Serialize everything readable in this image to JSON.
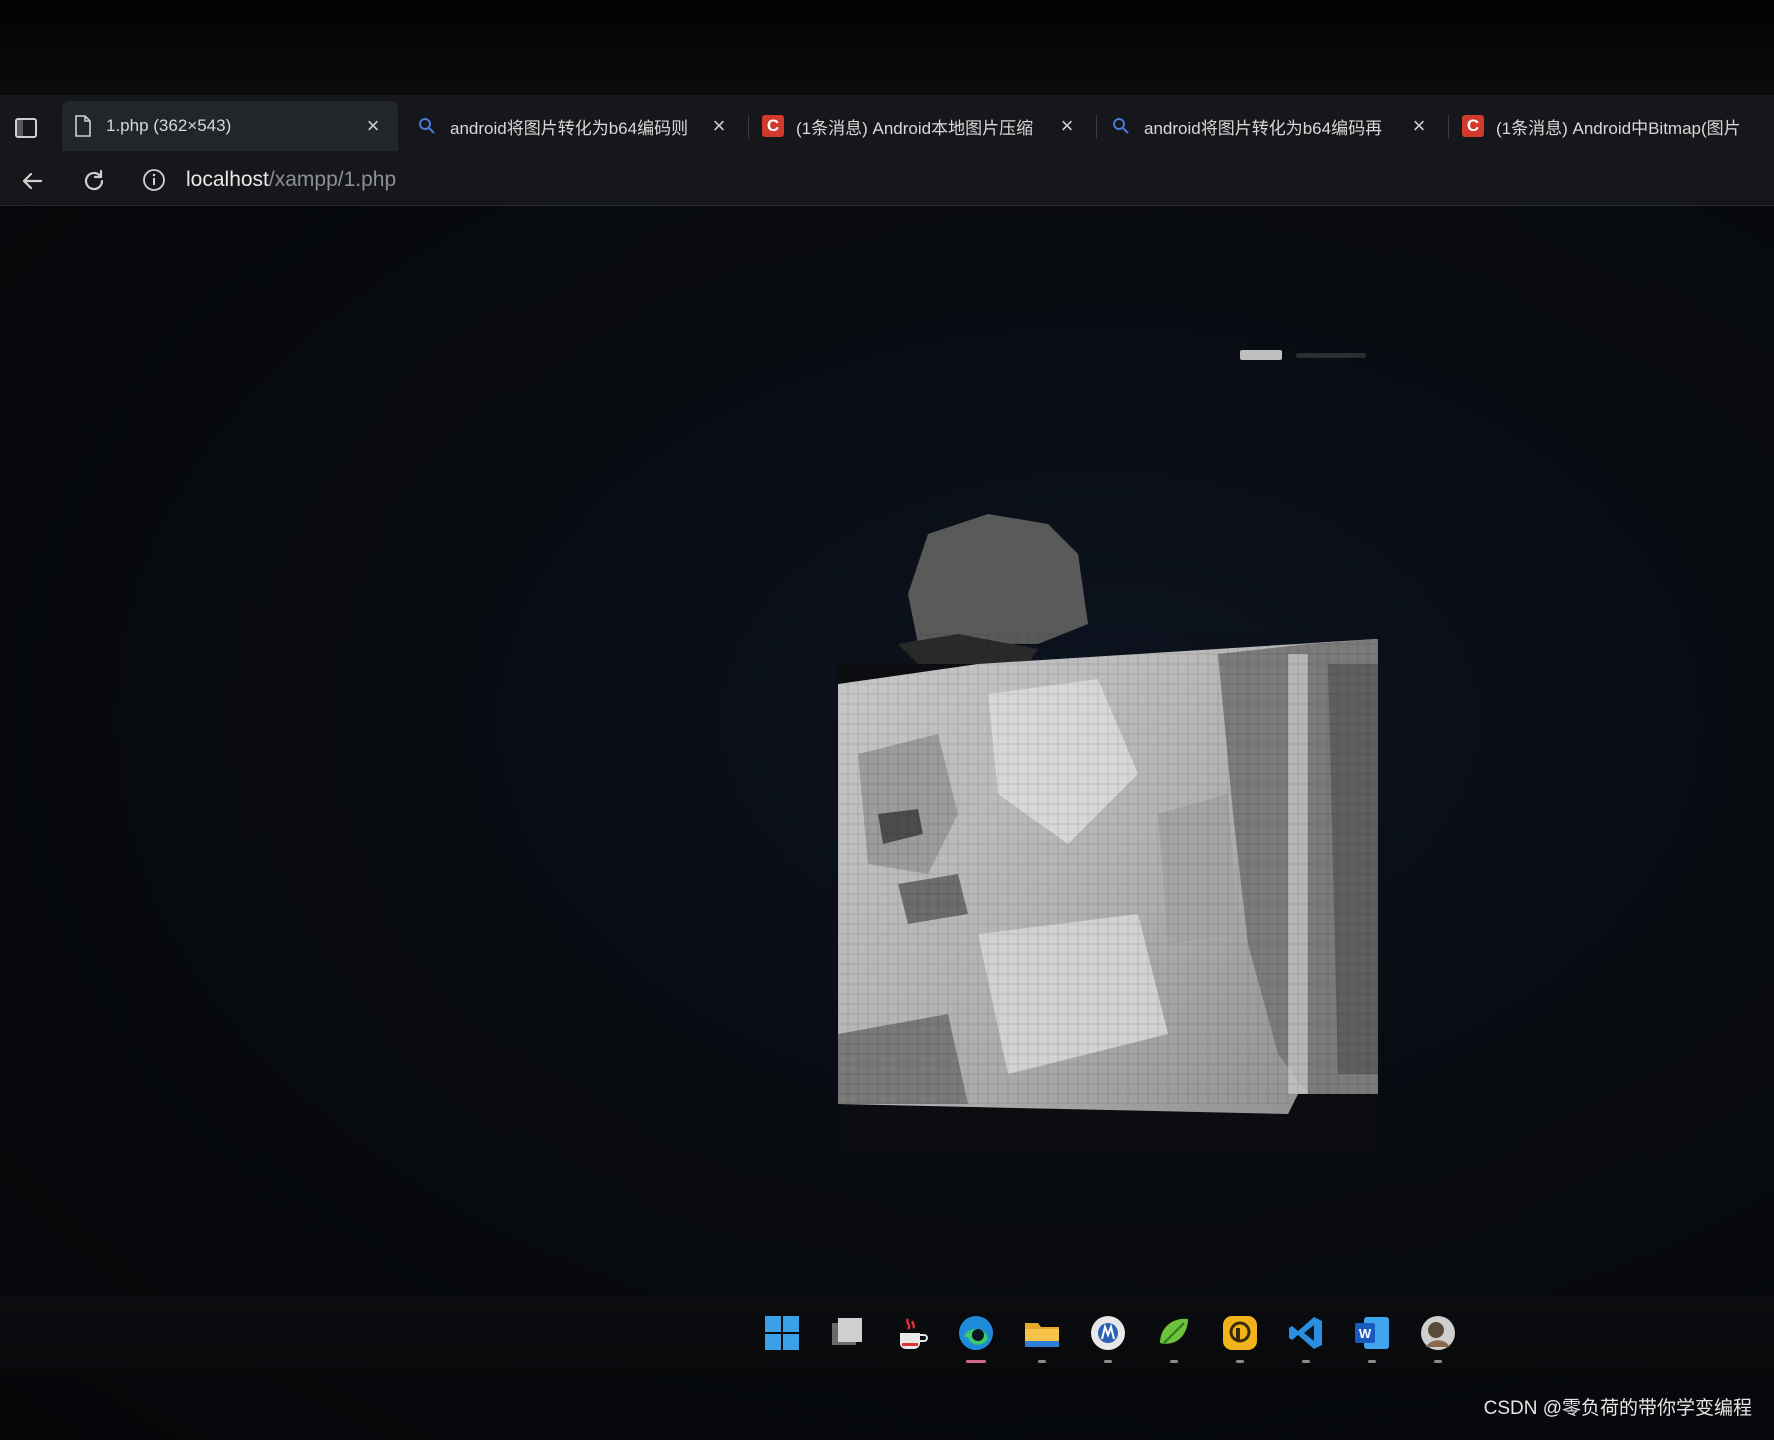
{
  "browser": {
    "tabs": [
      {
        "title": "1.php (362×543)",
        "icon": "file-icon",
        "active": true
      },
      {
        "title": "android将图片转化为b64编码则",
        "icon": "search-icon",
        "active": false
      },
      {
        "title": "(1条消息) Android本地图片压缩",
        "icon": "csdn-icon",
        "active": false
      },
      {
        "title": "android将图片转化为b64编码再",
        "icon": "search-icon",
        "active": false
      },
      {
        "title": "(1条消息) Android中Bitmap(图片",
        "icon": "csdn-icon",
        "active": false
      }
    ],
    "csdn_icon_letter": "C",
    "close_glyph": "×",
    "address": {
      "host": "localhost",
      "path": "/xampp/1.php"
    }
  },
  "taskbar": {
    "apps": [
      {
        "name": "start",
        "icon": "windows-start-icon"
      },
      {
        "name": "task-view",
        "icon": "task-view-icon"
      },
      {
        "name": "java",
        "icon": "java-icon"
      },
      {
        "name": "edge",
        "icon": "edge-browser-icon",
        "active": true
      },
      {
        "name": "file-explorer",
        "icon": "folder-icon"
      },
      {
        "name": "app-round",
        "icon": "circle-app-icon"
      },
      {
        "name": "app-leaf",
        "icon": "leaf-app-icon"
      },
      {
        "name": "app-yellow",
        "icon": "yellow-app-icon"
      },
      {
        "name": "vscode",
        "icon": "vscode-icon"
      },
      {
        "name": "word",
        "icon": "word-icon"
      },
      {
        "name": "avatar-app",
        "icon": "avatar-app-icon"
      }
    ],
    "word_letter": "W"
  },
  "watermark": "CSDN @零负荷的带你学变编程",
  "colors": {
    "accent_csdn": "#d23a2d",
    "tab_active_bg": "#22262b",
    "edge_indicator": "#d06a8a"
  }
}
